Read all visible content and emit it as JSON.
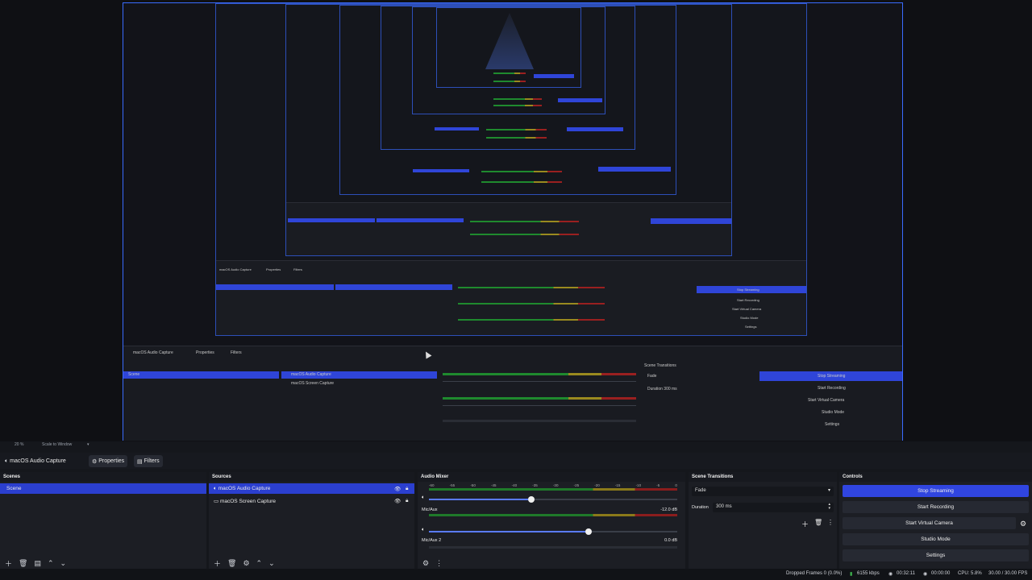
{
  "zoom": {
    "value": "20 %",
    "mode": "Scale to Window"
  },
  "toolbar": {
    "source_name": "macOS Audio Capture",
    "properties": "Properties",
    "filters": "Filters"
  },
  "scenes": {
    "title": "Scenes",
    "items": [
      "Scene"
    ]
  },
  "sources": {
    "title": "Sources",
    "items": [
      "macOS Audio Capture",
      "macOS Screen Capture"
    ]
  },
  "mixer": {
    "title": "Audio Mixer",
    "ticks": [
      "-60",
      "-55",
      "-50",
      "-45",
      "-40",
      "-35",
      "-30",
      "-25",
      "-20",
      "-15",
      "-10",
      "-5",
      "0"
    ],
    "channels": [
      {
        "name": "",
        "db": ""
      },
      {
        "name": "Mic/Aux",
        "db": "-12.0 dB"
      },
      {
        "name": "Mic/Aux 2",
        "db": "0.0 dB"
      }
    ]
  },
  "transitions": {
    "title": "Scene Transitions",
    "selected": "Fade",
    "duration_label": "Duration",
    "duration_value": "300 ms"
  },
  "controls": {
    "title": "Controls",
    "buttons": [
      "Stop Streaming",
      "Start Recording",
      "Start Virtual Camera",
      "Studio Mode",
      "Settings"
    ]
  },
  "status": {
    "dropped": "Dropped Frames 0 (0.0%)",
    "bitrate": "6155 kbps",
    "live_time": "00:32:11",
    "rec_time": "00:00:00",
    "cpu": "CPU: 5.8%",
    "fps": "30.00 / 30.00 FPS"
  },
  "colors": {
    "accent": "#2b3fcf",
    "bg": "#1c1e24",
    "stream_button": "#3045e0"
  },
  "icons": [
    "speaker-icon",
    "lock-icon",
    "eye-icon",
    "gear-icon",
    "plus-icon",
    "trash-icon",
    "filter-icon",
    "up-icon",
    "down-icon",
    "settings-cog-icon"
  ]
}
